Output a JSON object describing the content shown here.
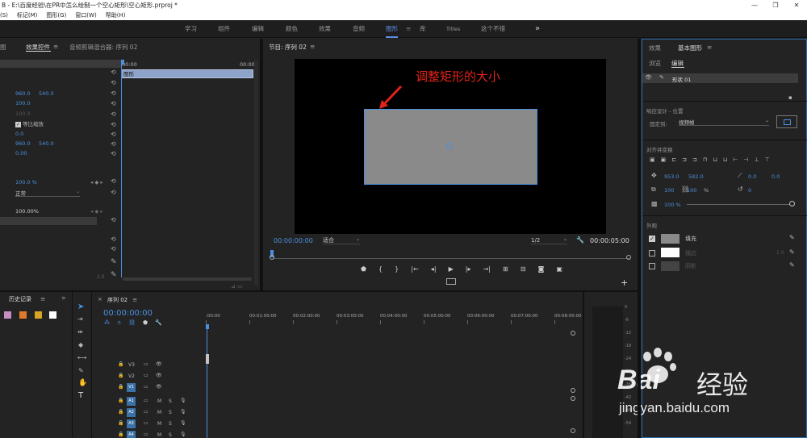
{
  "title": {
    "prefix": "B - ",
    "path": "E:\\百度经验\\在PR中怎么绘制一个空心矩形\\空心矩形.prproj *",
    "controls": [
      "—",
      "❐",
      "✕"
    ]
  },
  "menu": [
    "(S)",
    "标记(M)",
    "图形(G)",
    "窗口(W)",
    "帮助(H)"
  ],
  "workspaces": [
    "学习",
    "组件",
    "编辑",
    "颜色",
    "效果",
    "音频",
    "图形",
    "库",
    "Titles",
    "这个不错"
  ],
  "workspace_more": "»",
  "left_panel": {
    "tabs": [
      "图",
      "效果控件",
      "音频剪辑混合器: 序列 02"
    ],
    "menu": "≡",
    "timeline_start": "00:00",
    "timeline_end": "00:00",
    "clip": "图形",
    "values": {
      "pos_x": "960.0",
      "pos_y": "540.0",
      "scale": "100.0",
      "scale_dim": "100.0",
      "uniform": "等比缩放",
      "rot": "0.0",
      "anchor_x": "960.0",
      "anchor_y": "540.0",
      "flicker": "0.00",
      "opacity": "100.0 %",
      "blend": "正常",
      "speed": "100.00%"
    },
    "footer_num": "1.0"
  },
  "program": {
    "title": "节目: 序列 02",
    "menu": "≡",
    "annotation": "调整矩形的大小",
    "timecode": "00:00:00:00",
    "fit": "适合",
    "quality": "1/2",
    "duration": "00:00:05:00"
  },
  "right_panel": {
    "tabs": [
      "效果",
      "基本图形"
    ],
    "menu": "≡",
    "subtabs": [
      "浏览",
      "编辑"
    ],
    "layer": "形状 01",
    "responsive": "响应设计 - 位置",
    "pin_label": "固定到:",
    "pin_value": "视频帧",
    "align": "对齐并变换",
    "pos_x": "953.0",
    "pos_y": "582.0",
    "anchor_x": "0.0",
    "anchor_y": "0.0",
    "scale": "100",
    "scale_y": "100",
    "scale_unit": "%",
    "rotation": "0",
    "opacity": "100 %",
    "appearance": "外观",
    "fill": "填充",
    "stroke": "描边",
    "stroke_width": "1.0",
    "shadow": "阴影",
    "colors": {
      "fill": "#8a8a8a",
      "stroke": "#ffffff",
      "shadow": "#444444"
    }
  },
  "history": {
    "title": "历史记录",
    "menu": "»",
    "swatches": [
      "#c48fbf",
      "#e07a2a",
      "#d6a524",
      "#e0ad36",
      "#ffffff"
    ]
  },
  "timeline": {
    "title": "序列 02",
    "menu": "≡",
    "timecode": "00:00:00:00",
    "ruler": [
      ":00:00",
      "00:01:00:00",
      "00:02:00:00",
      "00:03:00:00",
      "00:04:00:00",
      "00:05:00:00",
      "00:06:00:00",
      "00:07:00:00",
      "00:08:00:00"
    ],
    "video_tracks": [
      "V3",
      "V2",
      "V1"
    ],
    "audio_tracks": [
      "A1",
      "A2",
      "A3",
      "A4"
    ],
    "m": "M",
    "s": "S"
  },
  "meter": {
    "labels": [
      "0",
      "-6",
      "-12",
      "-18",
      "-24",
      "-30",
      "-36",
      "-42",
      "-48",
      "-54"
    ]
  },
  "watermark": {
    "brand": "Bai",
    "brand2": "经验",
    "url": "jingyan.baidu.com"
  }
}
